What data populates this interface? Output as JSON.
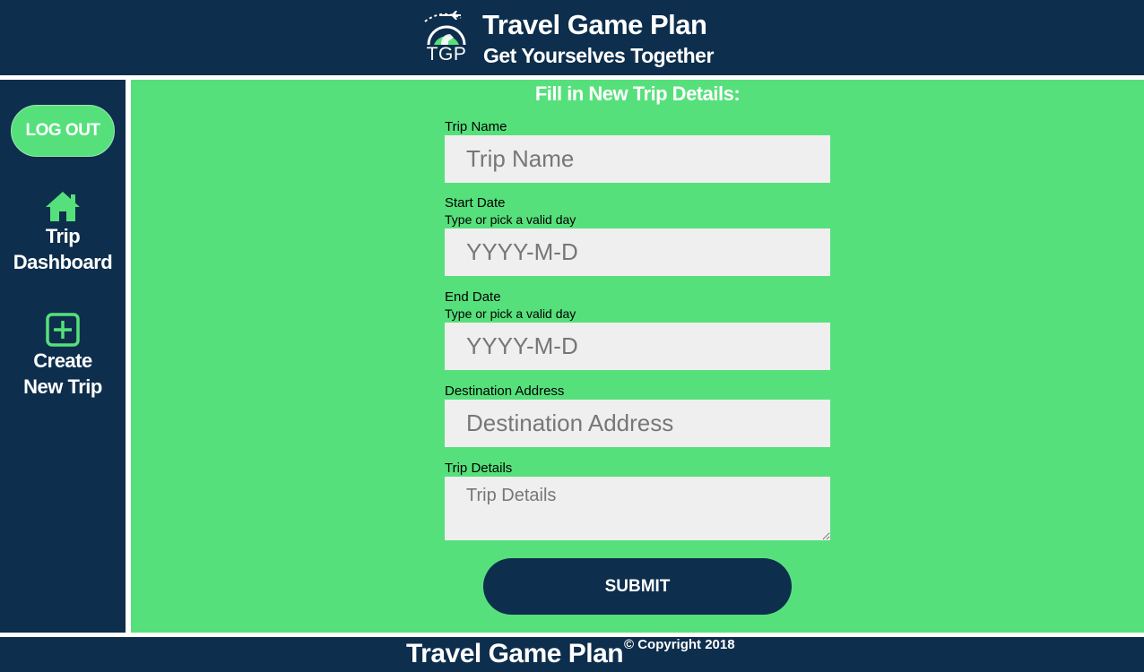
{
  "header": {
    "logo_text": "TGP",
    "title": "Travel Game Plan",
    "subtitle": "Get Yourselves Together"
  },
  "sidebar": {
    "logout_label": "LOG OUT",
    "items": [
      {
        "label_line1": "Trip",
        "label_line2": "Dashboard",
        "icon": "home-icon"
      },
      {
        "label_line1": "Create",
        "label_line2": "New Trip",
        "icon": "plus-square-icon"
      }
    ]
  },
  "form": {
    "title": "Fill in New Trip Details:",
    "trip_name": {
      "label": "Trip Name",
      "placeholder": "Trip Name",
      "value": ""
    },
    "start_date": {
      "label": "Start Date",
      "hint": "Type or pick a valid day",
      "placeholder": "YYYY-M-D",
      "value": ""
    },
    "end_date": {
      "label": "End Date",
      "hint": "Type or pick a valid day",
      "placeholder": "YYYY-M-D",
      "value": ""
    },
    "destination": {
      "label": "Destination Address",
      "placeholder": "Destination Address",
      "value": ""
    },
    "details": {
      "label": "Trip Details",
      "placeholder": "Trip Details",
      "value": ""
    },
    "submit_label": "SUBMIT"
  },
  "footer": {
    "brand": "Travel Game Plan",
    "copyright": "© Copyright 2018"
  },
  "colors": {
    "navy": "#0d2e4c",
    "green": "#56e07b",
    "input_bg": "#efefef",
    "white": "#ffffff"
  }
}
